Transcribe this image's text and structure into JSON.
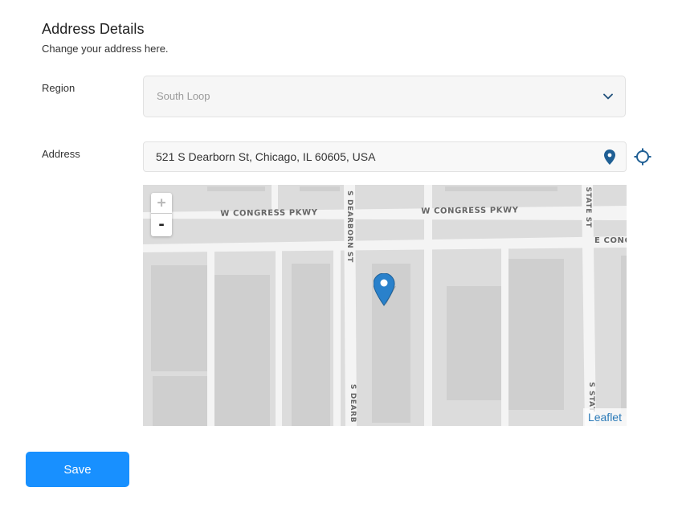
{
  "header": {
    "title": "Address Details",
    "subtitle": "Change your address here."
  },
  "region": {
    "label": "Region",
    "selected": "South Loop"
  },
  "address": {
    "label": "Address",
    "value": "521 S Dearborn St, Chicago, IL 60605, USA"
  },
  "map": {
    "zoom_in": "+",
    "zoom_out": "-",
    "attribution": "Leaflet",
    "streets": {
      "congress_left": "W CONGRESS PKWY",
      "congress_right": "W CONGRESS PKWY",
      "congress_east": "E CONG",
      "dearborn_top": "S DEARBORN ST",
      "dearborn_bottom": "S DEARB",
      "state_top": "STATE ST",
      "state_bottom": "S STAT"
    }
  },
  "actions": {
    "save_label": "Save"
  },
  "colors": {
    "primary": "#1890ff",
    "pin": "#1f5f94",
    "marker": "#2a81cb",
    "attribution": "#2a7ab8"
  }
}
